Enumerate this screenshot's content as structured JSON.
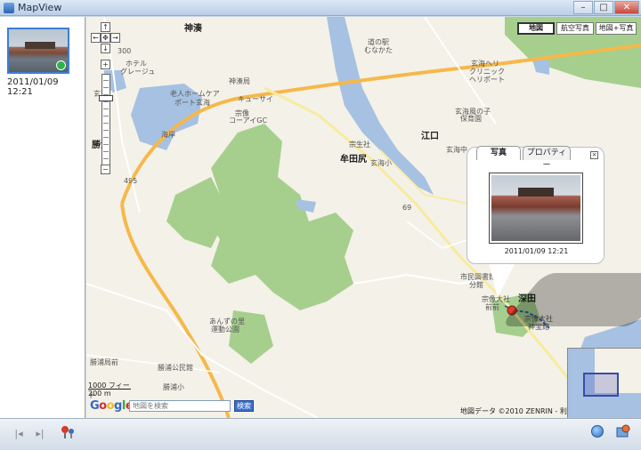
{
  "window": {
    "title": "MapView",
    "min_glyph": "–",
    "max_glyph": "□",
    "close_glyph": "✕"
  },
  "thumbnail": {
    "timestamp": "2011/01/09 12:21"
  },
  "map": {
    "type_buttons": [
      "地図",
      "航空写真",
      "地図+写真"
    ],
    "active_type": "地図",
    "labels": {
      "kounominato": "神湊",
      "hotel": "ホテル",
      "glacier": "グレージュ",
      "kounominato_sta": "神湊局",
      "nursing1": "老人ホームケア",
      "nursing2": "ポート玄海",
      "cue": "キューサイ",
      "munakata_kodai": "宗像",
      "kodai_cc": "コーアイGC",
      "katsuura": "勝浦",
      "kaike": "海岸",
      "route300": "300",
      "route495": "495",
      "route69": "69",
      "michinoeki1": "道の駅",
      "michinoeki2": "むなかた",
      "heliport1": "玄海ヘリ",
      "heliport2": "クリニック",
      "heliport3": "ヘリポート",
      "genkai_child1": "玄海風の子",
      "genkai_child2": "保育園",
      "eguchi": "江口",
      "genkai_jh": "玄海中",
      "munemori": "宗生社",
      "mutada_sho": "牟田尻",
      "mutada_sch": "玄海小",
      "muta": "牟田尻",
      "citizen1": "市民図書館",
      "citizen2": "分館",
      "munakata_shrine": "宗像大社",
      "shrine_front": "前前",
      "fukata": "深田",
      "taisha1": "宗像大社",
      "taisha2": "神宝館",
      "anoko1": "あんずの里",
      "anoko2": "運動公園",
      "katsuura_park": "勝浦公民館",
      "katsuura_sch": "勝浦小",
      "kaze": "玄海",
      "shirasaki": "勝浦局前"
    },
    "scale": {
      "feet": "1000 フィート",
      "meters": "200 m"
    },
    "search": {
      "placeholder": "地図を検索",
      "button": "検索"
    },
    "google_logo": "Google",
    "copyright": "地図データ ©2010 ZENRIN - 利用規約"
  },
  "info_window": {
    "tabs": [
      "写真",
      "プロパティー"
    ],
    "active_tab": "写真",
    "close_glyph": "×",
    "caption": "2011/01/09 12:21"
  },
  "toolbar": {
    "prev_glyph": "|◂",
    "next_glyph": "▸|"
  },
  "colors": {
    "water": "#a6c1e2",
    "park": "#a6cf8e",
    "highway": "#f6b84b",
    "road": "#ffffff",
    "secondary_road": "#f7ec9e",
    "land": "#f4f1e8"
  }
}
